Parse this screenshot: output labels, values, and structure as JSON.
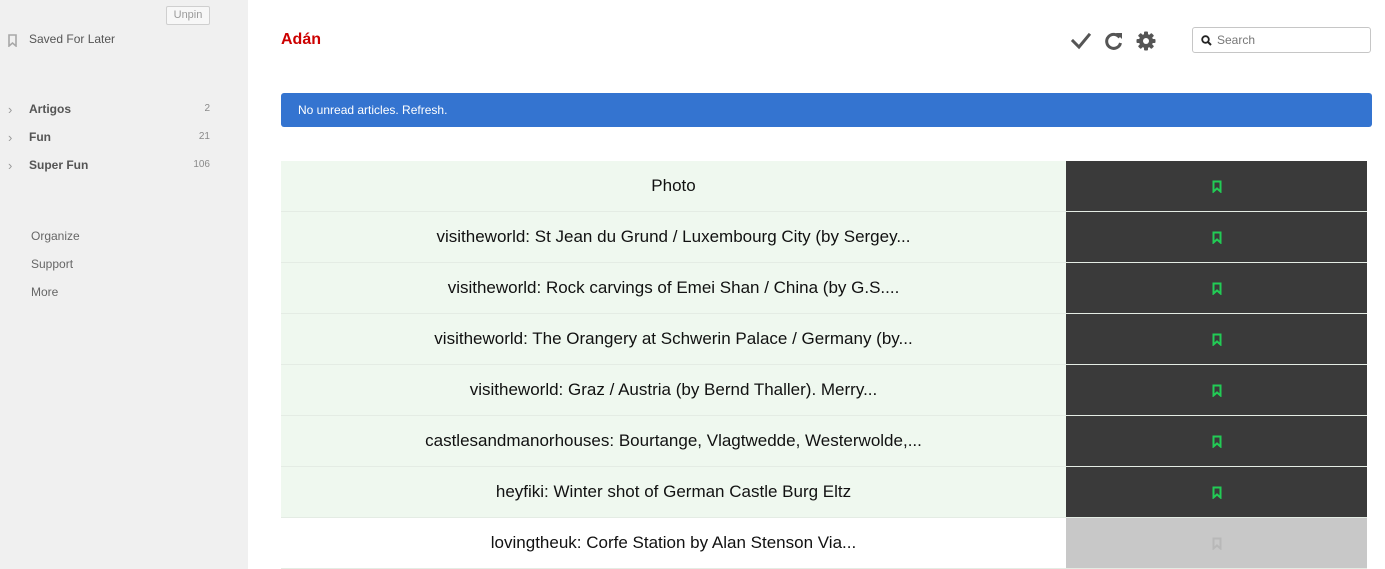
{
  "sidebar": {
    "unpin_label": "Unpin",
    "saved_label": "Saved For Later",
    "feeds": [
      {
        "name": "Artigos",
        "count": "2"
      },
      {
        "name": "Fun",
        "count": "21"
      },
      {
        "name": "Super Fun",
        "count": "106"
      }
    ],
    "links": [
      "Organize",
      "Support",
      "More"
    ]
  },
  "header": {
    "title": "Adán",
    "icons": [
      "checkmark-icon",
      "refresh-icon",
      "gear-icon"
    ],
    "search_placeholder": "Search"
  },
  "banner": {
    "text": "No unread articles. Refresh."
  },
  "articles": [
    {
      "title": "Photo",
      "saved": true
    },
    {
      "title": "visitheworld: St Jean du Grund / Luxembourg City (by Sergey...",
      "saved": true
    },
    {
      "title": "visitheworld: Rock carvings of Emei Shan / China (by G.S....",
      "saved": true
    },
    {
      "title": "visitheworld: The Orangery at Schwerin Palace / Germany (by...",
      "saved": true
    },
    {
      "title": "visitheworld: Graz / Austria (by Bernd Thaller). Merry...",
      "saved": true
    },
    {
      "title": "castlesandmanorhouses: Bourtange, Vlagtwedde, Westerwolde,...",
      "saved": true
    },
    {
      "title": "heyfiki: Winter shot of German Castle Burg Eltz",
      "saved": true
    },
    {
      "title": "lovingtheuk: Corfe Station by Alan Stenson Via...",
      "saved": false
    }
  ],
  "colors": {
    "title": "#cc0000",
    "banner": "#3474d0",
    "bookmark_saved": "#22cc55",
    "bookmark_unsaved": "#b8b8b8"
  }
}
